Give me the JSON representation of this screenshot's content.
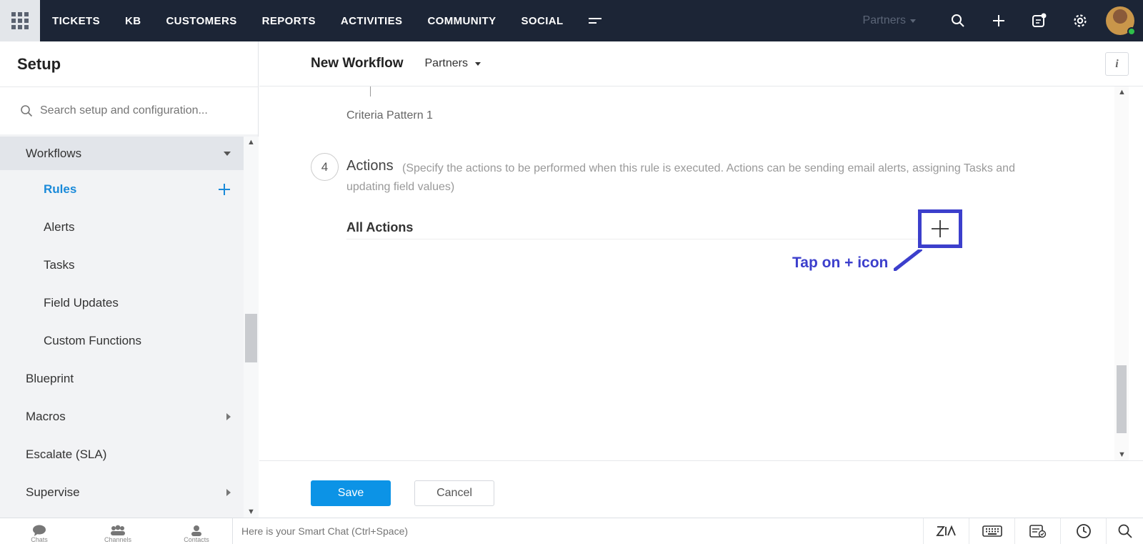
{
  "topnav": {
    "items": [
      "TICKETS",
      "KB",
      "CUSTOMERS",
      "REPORTS",
      "ACTIVITIES",
      "COMMUNITY",
      "SOCIAL"
    ],
    "department": "Partners"
  },
  "sidebar": {
    "title": "Setup",
    "search_placeholder": "Search setup and configuration...",
    "items": [
      {
        "label": "Workflows"
      },
      {
        "label": "Rules"
      },
      {
        "label": "Alerts"
      },
      {
        "label": "Tasks"
      },
      {
        "label": "Field Updates"
      },
      {
        "label": "Custom Functions"
      },
      {
        "label": "Blueprint"
      },
      {
        "label": "Macros"
      },
      {
        "label": "Escalate (SLA)"
      },
      {
        "label": "Supervise"
      }
    ]
  },
  "main": {
    "title": "New Workflow",
    "department": "Partners",
    "info": "i",
    "criteria_pattern": "Criteria Pattern 1",
    "step_number": "4",
    "actions_title": "Actions",
    "actions_description": "(Specify the actions to be performed when this rule is executed. Actions can be sending email alerts, assigning Tasks and updating field values)",
    "all_actions": "All Actions",
    "callout": "Tap on + icon",
    "accent_color": "#3c3fcc"
  },
  "footer": {
    "save": "Save",
    "cancel": "Cancel"
  },
  "bottombar": {
    "chats": "Chats",
    "channels": "Channels",
    "contacts": "Contacts",
    "smartchat_placeholder": "Here is your Smart Chat (Ctrl+Space)"
  }
}
